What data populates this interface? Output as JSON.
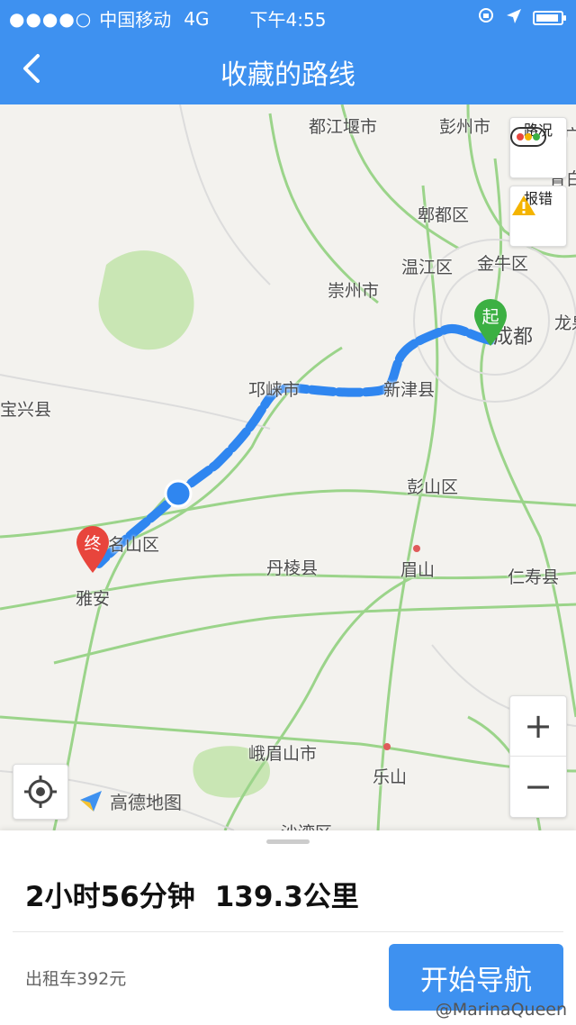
{
  "status_bar": {
    "carrier": "中国移动",
    "network": "4G",
    "time": "下午4:55"
  },
  "nav": {
    "title": "收藏的路线"
  },
  "map": {
    "places": [
      {
        "id": "dujiangyan",
        "name": "都江堰市"
      },
      {
        "id": "pengzhou",
        "name": "彭州市"
      },
      {
        "id": "pixian",
        "name": "郫都区"
      },
      {
        "id": "wenjiang",
        "name": "温江区"
      },
      {
        "id": "jinniu",
        "name": "金牛区"
      },
      {
        "id": "chongzhou",
        "name": "崇州市"
      },
      {
        "id": "chengdu",
        "name": "成都"
      },
      {
        "id": "long",
        "name": "龙泉"
      },
      {
        "id": "qionglai",
        "name": "邛崃市"
      },
      {
        "id": "xinjin",
        "name": "新津县"
      },
      {
        "id": "baoxing",
        "name": "宝兴县"
      },
      {
        "id": "pengshan",
        "name": "彭山区"
      },
      {
        "id": "mingshan",
        "name": "名山区"
      },
      {
        "id": "danleng",
        "name": "丹棱县"
      },
      {
        "id": "meishan",
        "name": "眉山"
      },
      {
        "id": "renshou",
        "name": "仁寿县"
      },
      {
        "id": "yaan",
        "name": "雅安"
      },
      {
        "id": "emeishan",
        "name": "峨眉山市"
      },
      {
        "id": "leshan",
        "name": "乐山"
      },
      {
        "id": "shawan",
        "name": "沙湾区"
      },
      {
        "id": "guang",
        "name": "广"
      },
      {
        "id": "qingbai",
        "name": "青白"
      }
    ],
    "start_marker": "起",
    "end_marker": "终",
    "traffic_label": "路况",
    "report_label": "报错",
    "zoom_in": "+",
    "zoom_out": "−",
    "provider": "高德地图",
    "route_color": "#2f86f0"
  },
  "route_summary": {
    "duration": "2小时56分钟",
    "distance": "139.3公里",
    "taxi_fare": "出租车392元",
    "start_button": "开始导航"
  },
  "watermark": "@MarinaQueen"
}
